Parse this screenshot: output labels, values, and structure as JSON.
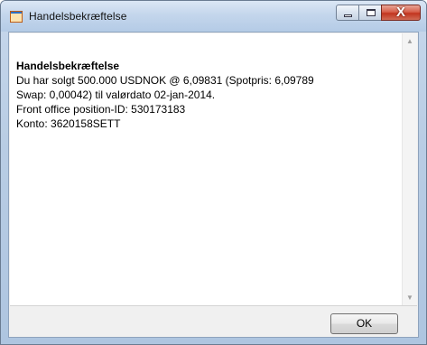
{
  "window": {
    "title": "Handelsbekræftelse"
  },
  "message": {
    "heading": "Handelsbekræftelse",
    "lines": [
      "Du har solgt 500.000 USDNOK @ 6,09831 (Spotpris: 6,09789",
      "Swap: 0,00042) til valørdato 02-jan-2014.",
      "Front office position-ID: 530173183",
      "Konto: 3620158SETT"
    ]
  },
  "buttons": {
    "ok_label": "OK",
    "close_glyph": "X"
  },
  "icons": {
    "app": "app-window-icon",
    "minimize": "minimize-icon",
    "maximize": "maximize-icon",
    "close": "close-icon",
    "scroll_up": "scroll-up-arrow-icon",
    "scroll_down": "scroll-down-arrow-icon"
  },
  "colors": {
    "title_bar": "#c4d6ec",
    "close_button": "#c2351f",
    "client_background": "#f0f0f0"
  }
}
